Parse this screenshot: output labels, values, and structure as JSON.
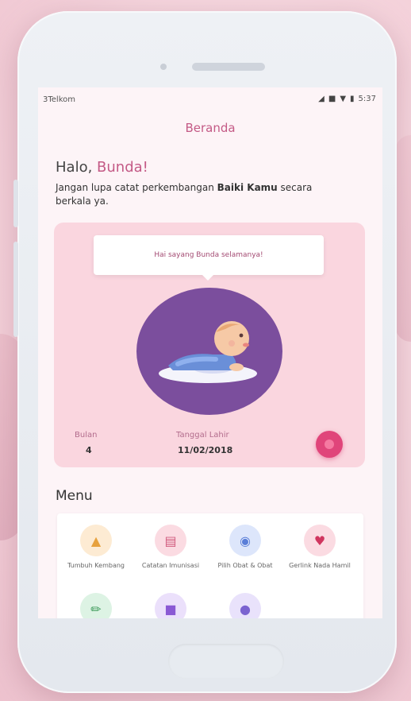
{
  "status_bar": {
    "carrier": "3Telkom",
    "time": "5:37"
  },
  "nav": {
    "title": "Beranda"
  },
  "greeting": {
    "prefix": "Halo, ",
    "name": "Bunda!",
    "message_start": "Jangan lupa catat perkembangan ",
    "message_bold": "Baiki Kamu",
    "message_end": " secara berkala ya."
  },
  "baby_card": {
    "banner_text": "Hai sayang Bunda selamanya!",
    "age_label": "Bulan",
    "age_value": "4",
    "dob_label": "Tanggal Lahir",
    "dob_value": "11/02/2018"
  },
  "menu": {
    "title": "Menu",
    "items": [
      {
        "label": "Tumbuh Kembang",
        "icon": "growth-icon"
      },
      {
        "label": "Catatan Imunisasi",
        "icon": "record-icon"
      },
      {
        "label": "Pilih Obat & Obat",
        "icon": "medicine-icon"
      },
      {
        "label": "Gerlink Nada Hamil",
        "icon": "pregnancy-icon"
      },
      {
        "label": "",
        "icon": "syringe-icon"
      },
      {
        "label": "",
        "icon": "notes-icon"
      },
      {
        "label": "",
        "icon": "chat-icon"
      }
    ]
  },
  "colors": {
    "accent": "#c45a86",
    "card_bg": "#fad6df",
    "circle": "#7b4e9d",
    "fab": "#e0457a"
  }
}
